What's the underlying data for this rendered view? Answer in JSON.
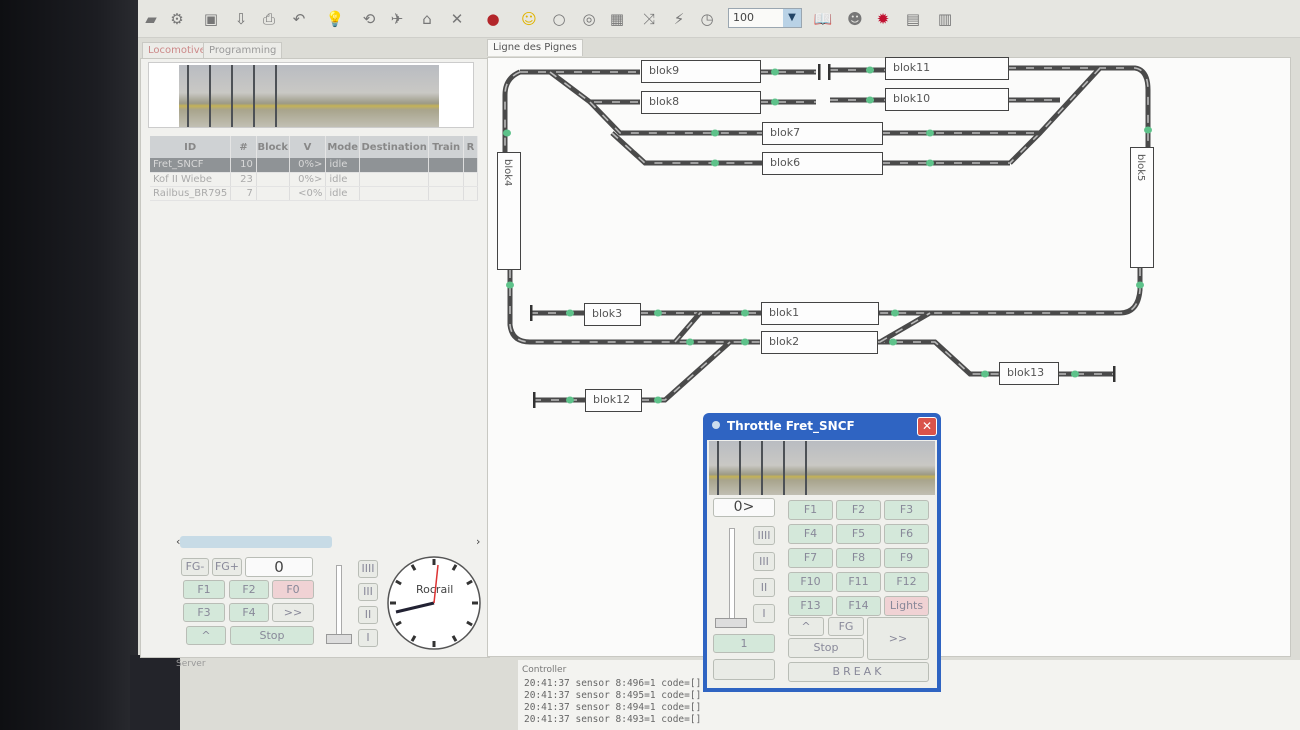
{
  "toolbar": {
    "icons": [
      "locomotives-icon",
      "turnouts-icon",
      "save-icon",
      "download-icon",
      "print-icon",
      "undo-icon",
      "bulb-icon",
      "loop-icon",
      "plane-icon",
      "house-icon",
      "close-icon",
      "stop-icon",
      "smiley-icon",
      "apple-icon",
      "search-icon",
      "grid-icon",
      "shuffle-icon",
      "connect-icon",
      "clock-icon",
      "book-icon",
      "people-icon",
      "alert-icon",
      "notepad-icon",
      "cabinet-icon"
    ],
    "zoom_value": "100"
  },
  "left_tabs": [
    "Locomotives",
    "Programming"
  ],
  "layout_tab": "Ligne des Pignes",
  "loco_table": {
    "columns": [
      "ID",
      "#",
      "Block",
      "V",
      "Mode",
      "Destination",
      "Train",
      "R"
    ],
    "rows": [
      {
        "id": "Fret_SNCF",
        "addr": "10",
        "block": "",
        "v": "0%>",
        "mode": "idle"
      },
      {
        "id": "Kof II Wiebe",
        "addr": "23",
        "block": "",
        "v": "0%>",
        "mode": "idle"
      },
      {
        "id": "Railbus_BR795",
        "addr": "7",
        "block": "",
        "v": "<0%",
        "mode": "idle"
      }
    ]
  },
  "mini_throttle": {
    "fg_minus": "FG-",
    "fg_plus": "FG+",
    "speed": "0",
    "f1": "F1",
    "f2": "F2",
    "f0": "F0",
    "f3": "F3",
    "f4": "F4",
    "next": ">>",
    "dir": "^",
    "stop": "Stop",
    "steps": [
      "IIII",
      "III",
      "II",
      "I"
    ],
    "clock_label": "Rocrail"
  },
  "server_label": "Server",
  "blocks": {
    "blok1": "blok1",
    "blok2": "blok2",
    "blok3": "blok3",
    "blok4": "blok4",
    "blok5": "blok5",
    "blok6": "blok6",
    "blok7": "blok7",
    "blok8": "blok8",
    "blok9": "blok9",
    "blok10": "blok10",
    "blok11": "blok11",
    "blok12": "blok12",
    "blok13": "blok13"
  },
  "throttle": {
    "title": "Throttle Fret_SNCF",
    "speed": "0>",
    "steps": [
      "IIII",
      "III",
      "II",
      "I"
    ],
    "address": "1",
    "functions": [
      "F1",
      "F2",
      "F3",
      "F4",
      "F5",
      "F6",
      "F7",
      "F8",
      "F9",
      "F10",
      "F11",
      "F12",
      "F13",
      "F14",
      "Lights"
    ],
    "dir": "^",
    "fg": "FG",
    "next": ">>",
    "stop": "Stop",
    "break": "BREAK"
  },
  "controller": {
    "label": "Controller",
    "log": [
      "20:41:37 sensor 8:496=1 code=[]",
      "20:41:37 sensor 8:495=1 code=[]",
      "20:41:37 sensor 8:494=1 code=[]",
      "20:41:37 sensor 8:493=1 code=[]"
    ]
  },
  "colors": {
    "title_bar": "#2f64c2",
    "function_button": "#d4e8da",
    "lights_button": "#f0d2d4",
    "sensor": "#5ec28a",
    "track": "#4a4a4a"
  }
}
